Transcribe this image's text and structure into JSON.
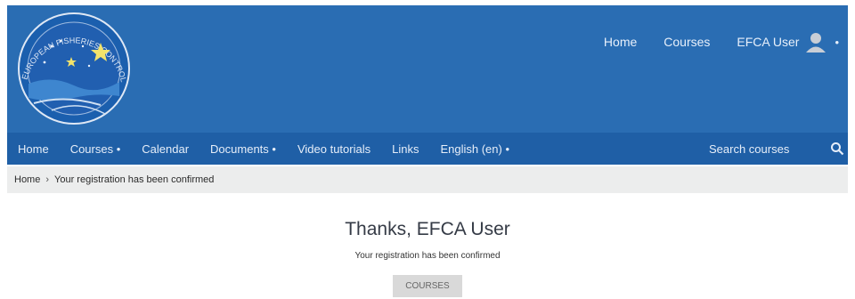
{
  "top_nav": {
    "home": "Home",
    "courses": "Courses",
    "user_name": "EFCA User",
    "user_caret": "•"
  },
  "main_nav": {
    "items": [
      "Home",
      "Courses •",
      "Calendar",
      "Documents •",
      "Video tutorials",
      "Links",
      "English ‎(en)‎ •"
    ],
    "search_placeholder": "Search courses"
  },
  "breadcrumb": {
    "home": "Home",
    "separator": "›",
    "current": "Your registration has been confirmed"
  },
  "main": {
    "heading": "Thanks, EFCA User",
    "message": "Your registration has been confirmed",
    "button_label": "COURSES"
  },
  "logo": {
    "text": "EUROPEAN FISHERIES CONTROL AGENCY"
  },
  "colors": {
    "header_bg": "#2a6db3",
    "nav_bg": "#1f5fa6",
    "breadcrumb_bg": "#eceded"
  }
}
